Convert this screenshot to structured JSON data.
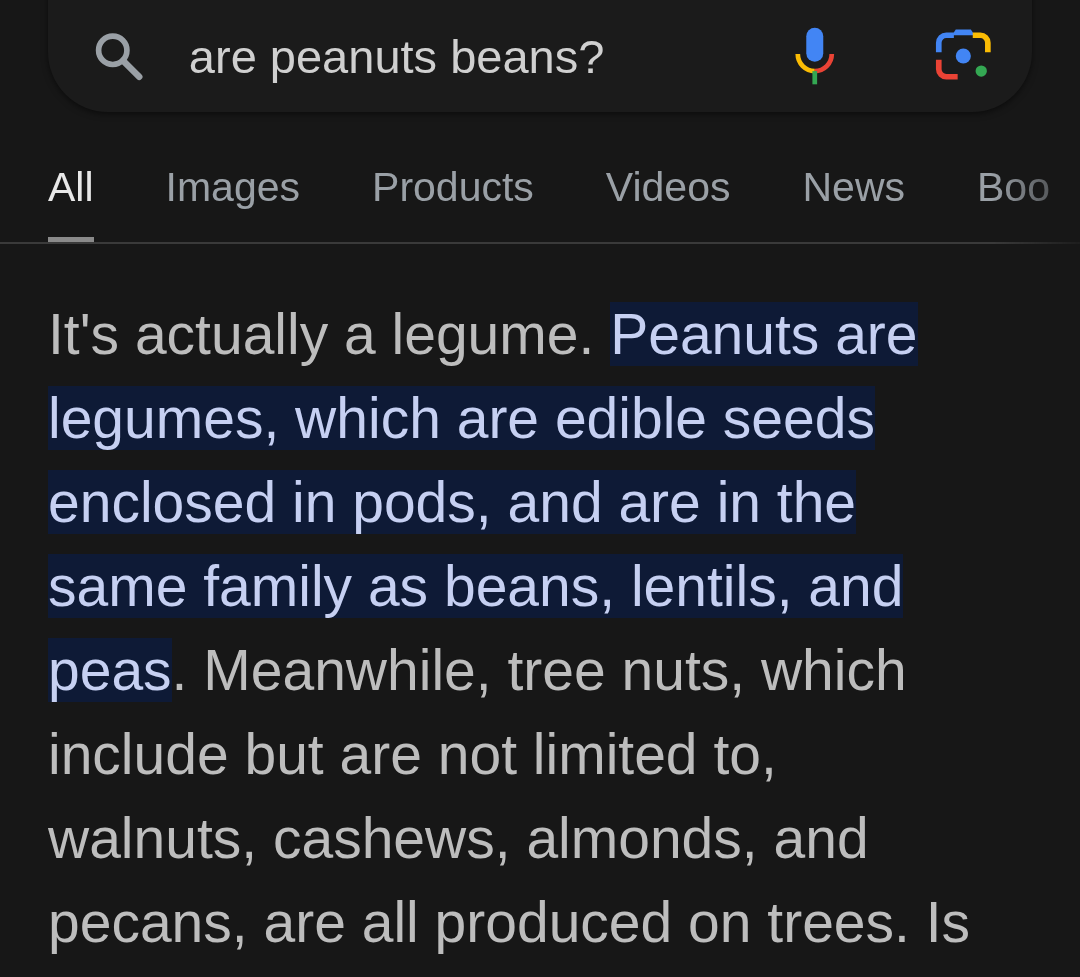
{
  "search": {
    "value": "are peanuts beans?"
  },
  "tabs": [
    {
      "label": "All",
      "selected": true
    },
    {
      "label": "Images",
      "selected": false
    },
    {
      "label": "Products",
      "selected": false
    },
    {
      "label": "Videos",
      "selected": false
    },
    {
      "label": "News",
      "selected": false
    },
    {
      "label": "Boo",
      "selected": false
    }
  ],
  "answer": {
    "segments": [
      {
        "text": "It's actually a legume. ",
        "highlighted": false
      },
      {
        "text": "Peanuts are legumes, which are edible seeds enclosed in pods, and are in the same family as beans, lentils, and peas",
        "highlighted": true
      },
      {
        "text": ". Meanwhile, tree nuts, which include but are not limited to, walnuts, cashews, almonds, and pecans, are all produced on trees. Is",
        "highlighted": false
      }
    ]
  }
}
